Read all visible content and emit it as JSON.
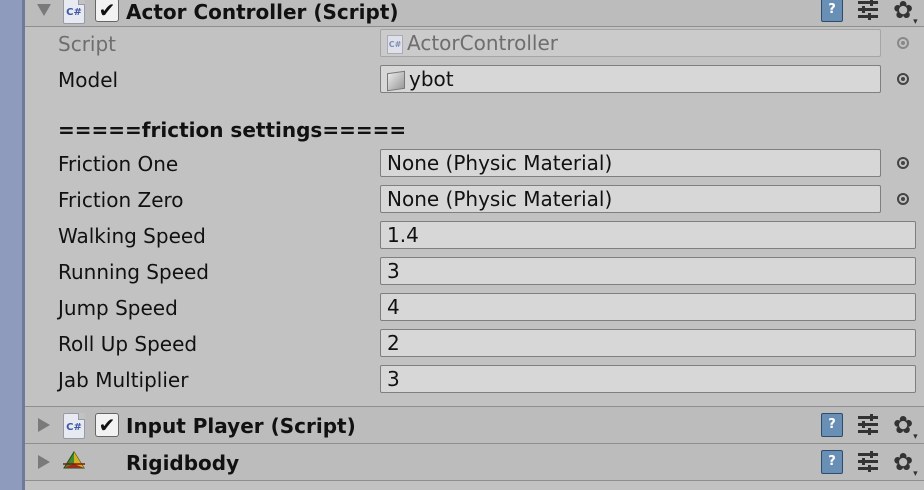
{
  "components": {
    "actor_controller": {
      "title": "Actor Controller (Script)",
      "enabled_check": "✔",
      "icon_text": "C#",
      "fields": {
        "script_label": "Script",
        "script_value": "ActorController",
        "model_label": "Model",
        "model_value": "ybot"
      },
      "section_header": "=====friction settings=====",
      "friction": {
        "one_label": "Friction One",
        "one_value": "None (Physic Material)",
        "zero_label": "Friction Zero",
        "zero_value": "None (Physic Material)"
      },
      "speeds": {
        "walking_label": "Walking Speed",
        "walking_value": "1.4",
        "running_label": "Running Speed",
        "running_value": "3",
        "jump_label": "Jump Speed",
        "jump_value": "4",
        "rollup_label": "Roll Up Speed",
        "rollup_value": "2",
        "jab_label": "Jab Multiplier",
        "jab_value": "3"
      }
    },
    "input_player": {
      "title": "Input Player (Script)",
      "enabled_check": "✔",
      "icon_text": "C#"
    },
    "rigidbody": {
      "title": "Rigidbody"
    }
  },
  "icons": {
    "help": "?",
    "gear": "✿",
    "gear_arrow": "▾"
  },
  "colors": {
    "panel_bg": "#c2c2c2",
    "header_bg": "#bcbcbc",
    "field_bg": "#d7d7d7",
    "help_icon": "#6a8fb4",
    "left_strip": "#8f9bbd"
  }
}
